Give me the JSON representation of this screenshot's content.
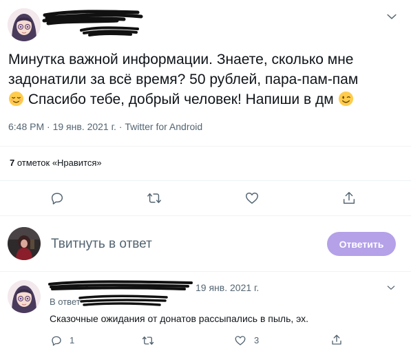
{
  "tweet": {
    "text_line1": "Минутка важной информации. Знаете, сколько мне",
    "text_line2": "задонатили за всё время? 50 рублей, пара-пам-пам",
    "text_line3": " Спасибо тебе, добрый человек! Напиши в дм ",
    "emoji1": "relieved-face",
    "emoji2": "winking-face",
    "meta": "6:48 PM · 19 янв. 2021 г. · Twitter for Android",
    "likes_count": "7",
    "likes_label": " отметок «Нравится»"
  },
  "actions": {
    "reply_icon": "reply-icon",
    "retweet_icon": "retweet-icon",
    "like_icon": "heart-icon",
    "share_icon": "share-icon"
  },
  "compose": {
    "placeholder": "Твитнуть в ответ",
    "button_label": "Ответить",
    "button_color": "#b4a1e8"
  },
  "reply": {
    "date": "19 янв. 2021 г.",
    "reply_to_prefix": "В ответ",
    "text": "Сказочные ожидания от донатов рассыпались в пыль, эх.",
    "reply_count": "1",
    "like_count": "3"
  },
  "colors": {
    "text": "#0f1419",
    "muted": "#536471",
    "divider": "#eff3f4"
  }
}
